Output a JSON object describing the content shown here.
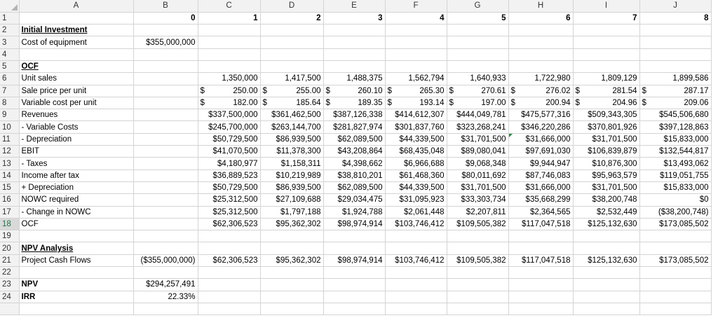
{
  "columns": [
    "A",
    "B",
    "C",
    "D",
    "E",
    "F",
    "G",
    "H",
    "I",
    "J"
  ],
  "year_header": {
    "row": "1",
    "values": [
      "",
      "0",
      "1",
      "2",
      "3",
      "4",
      "5",
      "6",
      "7",
      "8"
    ]
  },
  "rows": [
    {
      "n": "2",
      "a": "Initial Investment",
      "style": "ul",
      "cells": [
        "",
        "",
        "",
        "",
        "",
        "",
        "",
        "",
        ""
      ]
    },
    {
      "n": "3",
      "a": "Cost of equipment",
      "cells": [
        "$355,000,000",
        "",
        "",
        "",
        "",
        "",
        "",
        "",
        ""
      ]
    },
    {
      "n": "4",
      "a": "",
      "cells": [
        "",
        "",
        "",
        "",
        "",
        "",
        "",
        "",
        ""
      ]
    },
    {
      "n": "5",
      "a": "OCF",
      "style": "ul",
      "cells": [
        "",
        "",
        "",
        "",
        "",
        "",
        "",
        "",
        ""
      ]
    },
    {
      "n": "6",
      "a": "Unit sales",
      "cells": [
        "",
        "1,350,000",
        "1,417,500",
        "1,488,375",
        "1,562,794",
        "1,640,933",
        "1,722,980",
        "1,809,129",
        "1,899,586"
      ]
    },
    {
      "n": "7",
      "a": "Sale price per unit",
      "acct": true,
      "cells": [
        "",
        "250.00",
        "255.00",
        "260.10",
        "265.30",
        "270.61",
        "276.02",
        "281.54",
        "287.17"
      ]
    },
    {
      "n": "8",
      "a": "Variable cost per unit",
      "acct": true,
      "cells": [
        "",
        "182.00",
        "185.64",
        "189.35",
        "193.14",
        "197.00",
        "200.94",
        "204.96",
        "209.06"
      ]
    },
    {
      "n": "9",
      "a": "Revenues",
      "cells": [
        "",
        "$337,500,000",
        "$361,462,500",
        "$387,126,338",
        "$414,612,307",
        "$444,049,781",
        "$475,577,316",
        "$509,343,305",
        "$545,506,680"
      ]
    },
    {
      "n": "10",
      "a": "- Variable Costs",
      "cells": [
        "",
        "$245,700,000",
        "$263,144,700",
        "$281,827,974",
        "$301,837,760",
        "$323,268,241",
        "$346,220,286",
        "$370,801,926",
        "$397,128,863"
      ]
    },
    {
      "n": "11",
      "a": " - Depreciation",
      "cells": [
        "",
        "$50,729,500",
        "$86,939,500",
        "$62,089,500",
        "$44,339,500",
        "$31,701,500",
        "$31,666,000",
        "$31,701,500",
        "$15,833,000"
      ]
    },
    {
      "n": "12",
      "a": "EBIT",
      "cells": [
        "",
        "$41,070,500",
        "$11,378,300",
        "$43,208,864",
        "$68,435,048",
        "$89,080,041",
        "$97,691,030",
        "$106,839,879",
        "$132,544,817"
      ]
    },
    {
      "n": "13",
      "a": "- Taxes",
      "cells": [
        "",
        "$4,180,977",
        "$1,158,311",
        "$4,398,662",
        "$6,966,688",
        "$9,068,348",
        "$9,944,947",
        "$10,876,300",
        "$13,493,062"
      ]
    },
    {
      "n": "14",
      "a": "Income after tax",
      "cells": [
        "",
        "$36,889,523",
        "$10,219,989",
        "$38,810,201",
        "$61,468,360",
        "$80,011,692",
        "$87,746,083",
        "$95,963,579",
        "$119,051,755"
      ]
    },
    {
      "n": "15",
      "a": "+ Depreciation",
      "cells": [
        "",
        "$50,729,500",
        "$86,939,500",
        "$62,089,500",
        "$44,339,500",
        "$31,701,500",
        "$31,666,000",
        "$31,701,500",
        "$15,833,000"
      ]
    },
    {
      "n": "16",
      "a": "NOWC required",
      "cells": [
        "",
        "$25,312,500",
        "$27,109,688",
        "$29,034,475",
        "$31,095,923",
        "$33,303,734",
        "$35,668,299",
        "$38,200,748",
        "$0"
      ]
    },
    {
      "n": "17",
      "a": " - Change in NOWC",
      "cells": [
        "",
        "$25,312,500",
        "$1,797,188",
        "$1,924,788",
        "$2,061,448",
        "$2,207,811",
        "$2,364,565",
        "$2,532,449",
        "($38,200,748)"
      ]
    },
    {
      "n": "18",
      "a": "OCF",
      "sel": true,
      "cells": [
        "",
        "$62,306,523",
        "$95,362,302",
        "$98,974,914",
        "$103,746,412",
        "$109,505,382",
        "$117,047,518",
        "$125,132,630",
        "$173,085,502"
      ]
    },
    {
      "n": "19",
      "a": "",
      "cells": [
        "",
        "",
        "",
        "",
        "",
        "",
        "",
        "",
        ""
      ]
    },
    {
      "n": "20",
      "a": "NPV Analysis",
      "style": "ul",
      "cells": [
        "",
        "",
        "",
        "",
        "",
        "",
        "",
        "",
        ""
      ]
    },
    {
      "n": "21",
      "a": "Project Cash Flows",
      "cells": [
        "($355,000,000)",
        "$62,306,523",
        "$95,362,302",
        "$98,974,914",
        "$103,746,412",
        "$109,505,382",
        "$117,047,518",
        "$125,132,630",
        "$173,085,502"
      ]
    },
    {
      "n": "22",
      "a": "",
      "cells": [
        "",
        "",
        "",
        "",
        "",
        "",
        "",
        "",
        ""
      ]
    },
    {
      "n": "23",
      "a": "NPV",
      "style": "bold",
      "cells": [
        "$294,257,491",
        "",
        "",
        "",
        "",
        "",
        "",
        "",
        ""
      ]
    },
    {
      "n": "24",
      "a": "IRR",
      "style": "bold",
      "cells": [
        "22.33%",
        "",
        "",
        "",
        "",
        "",
        "",
        "",
        ""
      ]
    }
  ],
  "truncated_row": "25",
  "currency_symbol": "$",
  "colors": {
    "header_bg": "#f2f2f2",
    "grid": "#d4d4d4",
    "selected_row": "#217346",
    "error_flag": "#1e8e3e"
  }
}
